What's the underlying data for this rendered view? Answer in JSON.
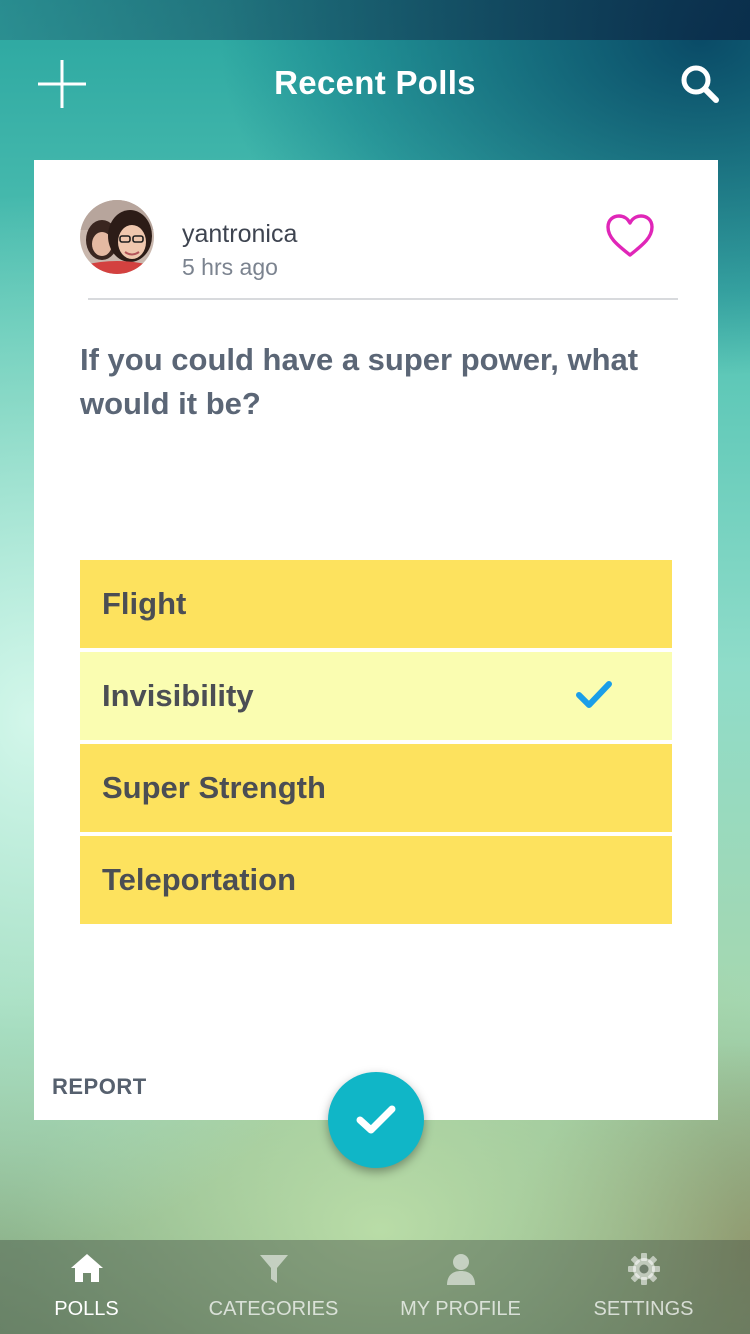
{
  "header": {
    "title": "Recent Polls",
    "add_icon": "plus-icon",
    "search_icon": "search-icon"
  },
  "poll": {
    "author": {
      "username": "yantronica",
      "time_ago": "5 hrs ago"
    },
    "favorite_icon": "heart-outline-icon",
    "favorite_color": "#e026b8",
    "question": "If you could have a super power, what would it be?",
    "options": [
      {
        "label": "Flight",
        "selected": false
      },
      {
        "label": "Invisibility",
        "selected": true
      },
      {
        "label": "Super Strength",
        "selected": false
      },
      {
        "label": "Teleportation",
        "selected": false
      }
    ],
    "report_label": "REPORT",
    "submit_icon": "checkmark-icon"
  },
  "tabs": [
    {
      "label": "POLLS",
      "icon": "home-icon",
      "active": true
    },
    {
      "label": "CATEGORIES",
      "icon": "filter-icon",
      "active": false
    },
    {
      "label": "MY PROFILE",
      "icon": "person-icon",
      "active": false
    },
    {
      "label": "SETTINGS",
      "icon": "gear-icon",
      "active": false
    }
  ],
  "colors": {
    "option_bg": "#fde25e",
    "option_selected_bg": "#fafdb1",
    "check_color": "#1b9ee8",
    "submit_bg": "#10b6c7"
  }
}
